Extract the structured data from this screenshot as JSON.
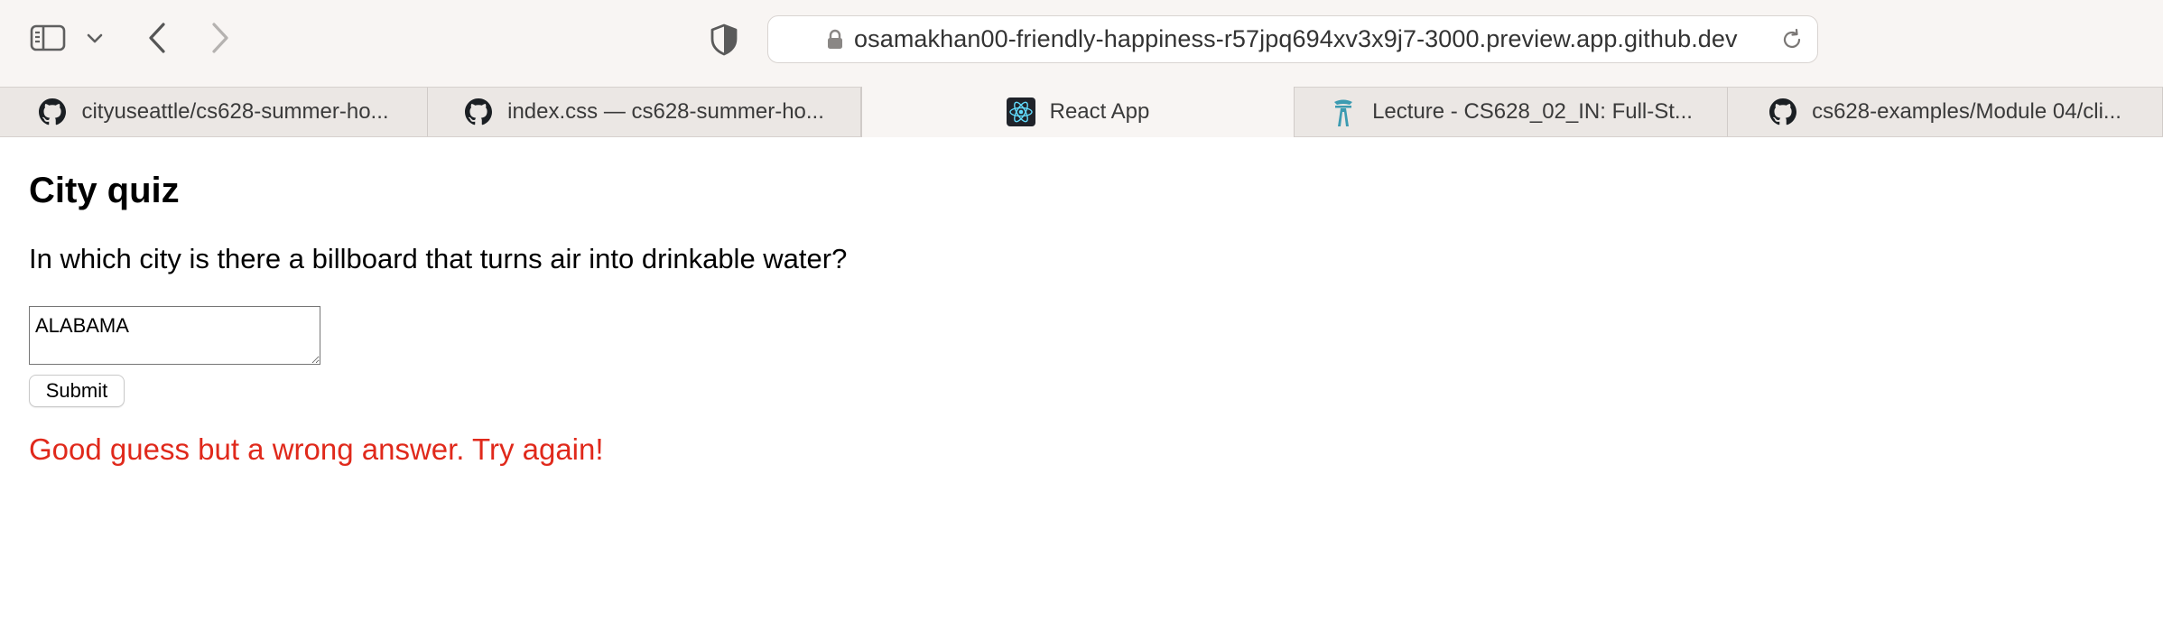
{
  "browser": {
    "url": "osamakhan00-friendly-happiness-r57jpq694xv3x9j7-3000.preview.app.github.dev",
    "icons": {
      "sidebar": "sidebar-icon",
      "chevron": "chevron-down-icon",
      "back": "back-arrow-icon",
      "forward": "forward-arrow-icon",
      "privacy": "shield-icon",
      "lock": "lock-icon",
      "reload": "reload-icon"
    }
  },
  "tabs": [
    {
      "label": "cityuseattle/cs628-summer-ho...",
      "icon": "github-icon",
      "active": false
    },
    {
      "label": "index.css — cs628-summer-ho...",
      "icon": "github-icon",
      "active": false
    },
    {
      "label": "React App",
      "icon": "react-icon",
      "active": true
    },
    {
      "label": "Lecture - CS628_02_IN: Full-St...",
      "icon": "space-needle-icon",
      "active": false
    },
    {
      "label": "cs628-examples/Module 04/cli...",
      "icon": "github-icon",
      "active": false
    }
  ],
  "page": {
    "title": "City quiz",
    "question": "In which city is there a billboard that turns air into drinkable water?",
    "answer_value": "ALABAMA",
    "submit_label": "Submit",
    "result_message": "Good guess but a wrong answer. Try again!",
    "colors": {
      "error": "#e0291b",
      "react_bg": "#20232a",
      "react_accent": "#61dafb"
    }
  }
}
